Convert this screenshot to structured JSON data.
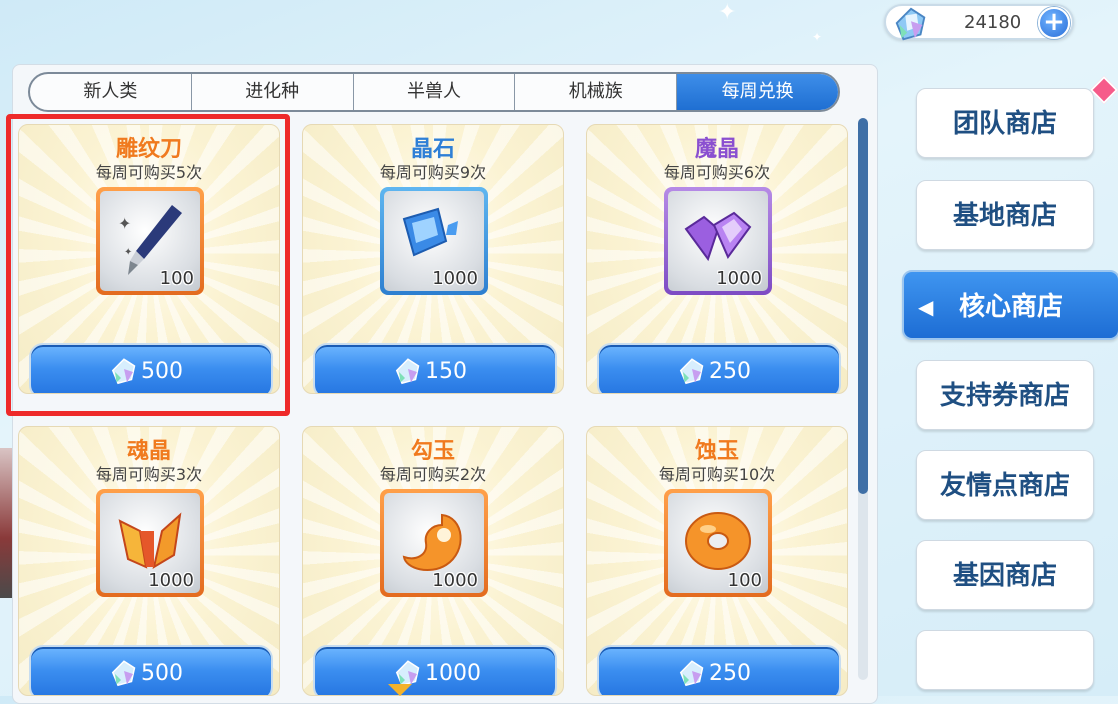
{
  "currency": {
    "amount": "24180",
    "icon": "crystal-gem-icon",
    "plus_icon": "plus-icon"
  },
  "tabs": [
    {
      "label": "新人类",
      "active": false
    },
    {
      "label": "进化种",
      "active": false
    },
    {
      "label": "半兽人",
      "active": false
    },
    {
      "label": "机械族",
      "active": false
    },
    {
      "label": "每周兑换",
      "active": true
    }
  ],
  "items": [
    {
      "name": "雕纹刀",
      "limit": "每周可购买5次",
      "qty": "100",
      "price": "500",
      "icon": "carving-knife-icon",
      "rarity": "orange",
      "name_color": "#f07a1e"
    },
    {
      "name": "晶石",
      "limit": "每周可购买9次",
      "qty": "1000",
      "price": "150",
      "icon": "blue-crystal-icon",
      "rarity": "blue",
      "name_color": "#2e7fd6"
    },
    {
      "name": "魔晶",
      "limit": "每周可购买6次",
      "qty": "1000",
      "price": "250",
      "icon": "purple-crystal-icon",
      "rarity": "purple",
      "name_color": "#8a4fd0"
    },
    {
      "name": "魂晶",
      "limit": "每周可购买3次",
      "qty": "1000",
      "price": "500",
      "icon": "soul-crystal-icon",
      "rarity": "orange",
      "name_color": "#f07a1e"
    },
    {
      "name": "勾玉",
      "limit": "每周可购买2次",
      "qty": "1000",
      "price": "1000",
      "icon": "magatama-icon",
      "rarity": "orange",
      "name_color": "#f07a1e"
    },
    {
      "name": "蚀玉",
      "limit": "每周可购买10次",
      "qty": "100",
      "price": "250",
      "icon": "jade-ring-icon",
      "rarity": "orange",
      "name_color": "#f07a1e"
    }
  ],
  "nav": [
    {
      "label": "团队商店",
      "active": false
    },
    {
      "label": "基地商店",
      "active": false
    },
    {
      "label": "核心商店",
      "active": true
    },
    {
      "label": "支持券商店",
      "active": false
    },
    {
      "label": "友情点商店",
      "active": false
    },
    {
      "label": "基因商店",
      "active": false
    },
    {
      "label": "",
      "active": false
    }
  ],
  "colors": {
    "accent": "#2474e0",
    "highlight": "#ee2a2a",
    "nav_text": "#1f4f82"
  }
}
